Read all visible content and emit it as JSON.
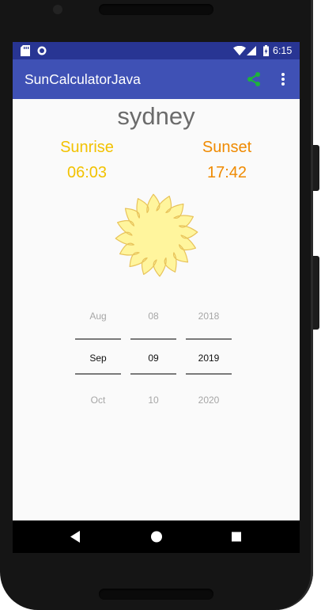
{
  "status_bar": {
    "time": "6:15"
  },
  "app_bar": {
    "title": "SunCalculatorJava",
    "share_icon": "share-icon",
    "menu_icon": "overflow-menu-icon"
  },
  "main": {
    "city": "sydney",
    "sunrise": {
      "label": "Sunrise",
      "time": "06:03",
      "color": "#f2c200"
    },
    "sunset": {
      "label": "Sunset",
      "time": "17:42",
      "color": "#ef8a00"
    },
    "sun_icon": "sun-icon"
  },
  "date_picker": {
    "month": {
      "prev": "Aug",
      "selected": "Sep",
      "next": "Oct"
    },
    "day": {
      "prev": "08",
      "selected": "09",
      "next": "10"
    },
    "year": {
      "prev": "2018",
      "selected": "2019",
      "next": "2020"
    }
  },
  "nav_bar": {
    "back_icon": "back-icon",
    "home_icon": "home-icon",
    "recents_icon": "recents-icon"
  },
  "colors": {
    "status_bar": "#283593",
    "app_bar": "#3f51b5",
    "share_icon": "#1db33b"
  }
}
